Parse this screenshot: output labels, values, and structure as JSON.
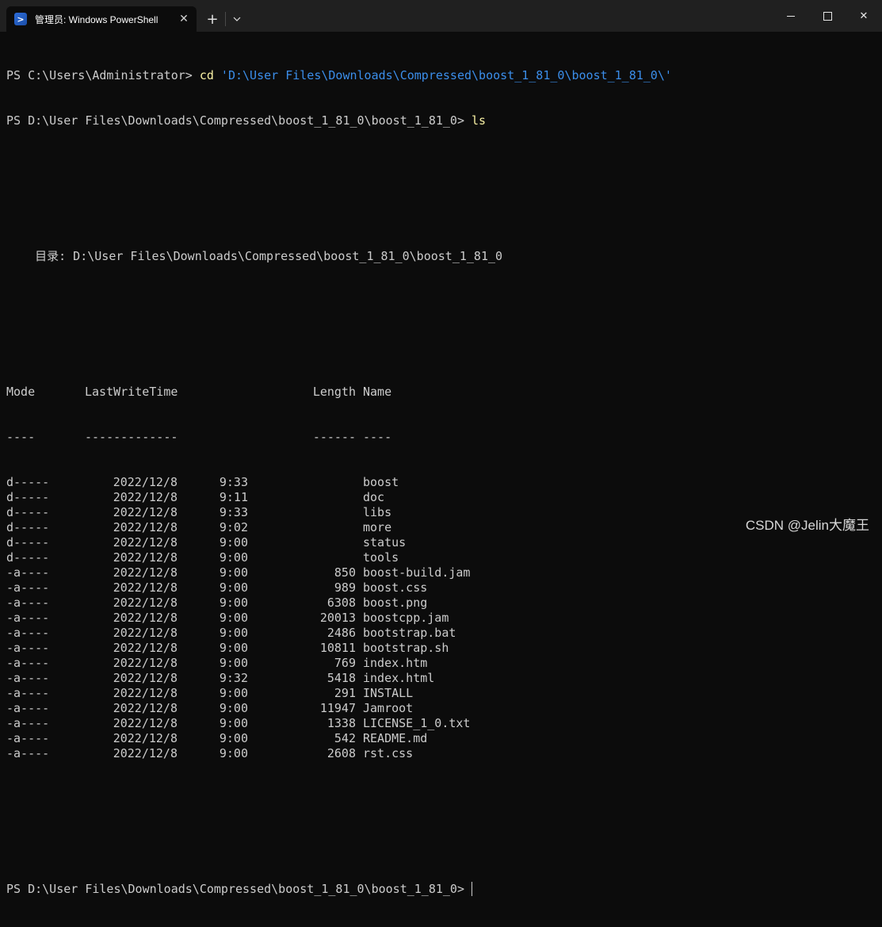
{
  "window": {
    "tab_title": "管理员: Windows PowerShell",
    "tab_icon": "powershell-icon",
    "tab_close_glyph": "✕",
    "new_tab_glyph": "+",
    "close_glyph": "✕"
  },
  "terminal": {
    "prompt1": "PS C:\\Users\\Administrator> ",
    "cmd1": "cd",
    "arg1": " 'D:\\User Files\\Downloads\\Compressed\\boost_1_81_0\\boost_1_81_0\\'",
    "prompt2": "PS D:\\User Files\\Downloads\\Compressed\\boost_1_81_0\\boost_1_81_0> ",
    "cmd2": "ls",
    "directory_line": "    目录: D:\\User Files\\Downloads\\Compressed\\boost_1_81_0\\boost_1_81_0",
    "headers": {
      "mode": "Mode",
      "lastwrite": "LastWriteTime",
      "length": "Length",
      "name": "Name"
    },
    "underlines": {
      "mode": "----",
      "lastwrite": "-------------",
      "length": "------",
      "name": "----"
    },
    "rows": [
      {
        "mode": "d-----",
        "date": "2022/12/8",
        "time": "9:33",
        "length": "",
        "name": "boost"
      },
      {
        "mode": "d-----",
        "date": "2022/12/8",
        "time": "9:11",
        "length": "",
        "name": "doc"
      },
      {
        "mode": "d-----",
        "date": "2022/12/8",
        "time": "9:33",
        "length": "",
        "name": "libs"
      },
      {
        "mode": "d-----",
        "date": "2022/12/8",
        "time": "9:02",
        "length": "",
        "name": "more"
      },
      {
        "mode": "d-----",
        "date": "2022/12/8",
        "time": "9:00",
        "length": "",
        "name": "status"
      },
      {
        "mode": "d-----",
        "date": "2022/12/8",
        "time": "9:00",
        "length": "",
        "name": "tools"
      },
      {
        "mode": "-a----",
        "date": "2022/12/8",
        "time": "9:00",
        "length": "850",
        "name": "boost-build.jam"
      },
      {
        "mode": "-a----",
        "date": "2022/12/8",
        "time": "9:00",
        "length": "989",
        "name": "boost.css"
      },
      {
        "mode": "-a----",
        "date": "2022/12/8",
        "time": "9:00",
        "length": "6308",
        "name": "boost.png"
      },
      {
        "mode": "-a----",
        "date": "2022/12/8",
        "time": "9:00",
        "length": "20013",
        "name": "boostcpp.jam"
      },
      {
        "mode": "-a----",
        "date": "2022/12/8",
        "time": "9:00",
        "length": "2486",
        "name": "bootstrap.bat"
      },
      {
        "mode": "-a----",
        "date": "2022/12/8",
        "time": "9:00",
        "length": "10811",
        "name": "bootstrap.sh"
      },
      {
        "mode": "-a----",
        "date": "2022/12/8",
        "time": "9:00",
        "length": "769",
        "name": "index.htm"
      },
      {
        "mode": "-a----",
        "date": "2022/12/8",
        "time": "9:32",
        "length": "5418",
        "name": "index.html"
      },
      {
        "mode": "-a----",
        "date": "2022/12/8",
        "time": "9:00",
        "length": "291",
        "name": "INSTALL"
      },
      {
        "mode": "-a----",
        "date": "2022/12/8",
        "time": "9:00",
        "length": "11947",
        "name": "Jamroot"
      },
      {
        "mode": "-a----",
        "date": "2022/12/8",
        "time": "9:00",
        "length": "1338",
        "name": "LICENSE_1_0.txt"
      },
      {
        "mode": "-a----",
        "date": "2022/12/8",
        "time": "9:00",
        "length": "542",
        "name": "README.md"
      },
      {
        "mode": "-a----",
        "date": "2022/12/8",
        "time": "9:00",
        "length": "2608",
        "name": "rst.css"
      }
    ],
    "prompt3": "PS D:\\User Files\\Downloads\\Compressed\\boost_1_81_0\\boost_1_81_0>"
  },
  "watermark": "CSDN @Jelin大魔王",
  "colors": {
    "background": "#0c0c0c",
    "text": "#cccccc",
    "command": "#f9f1a5",
    "argument": "#3b8eea",
    "titlebar": "#202020"
  }
}
